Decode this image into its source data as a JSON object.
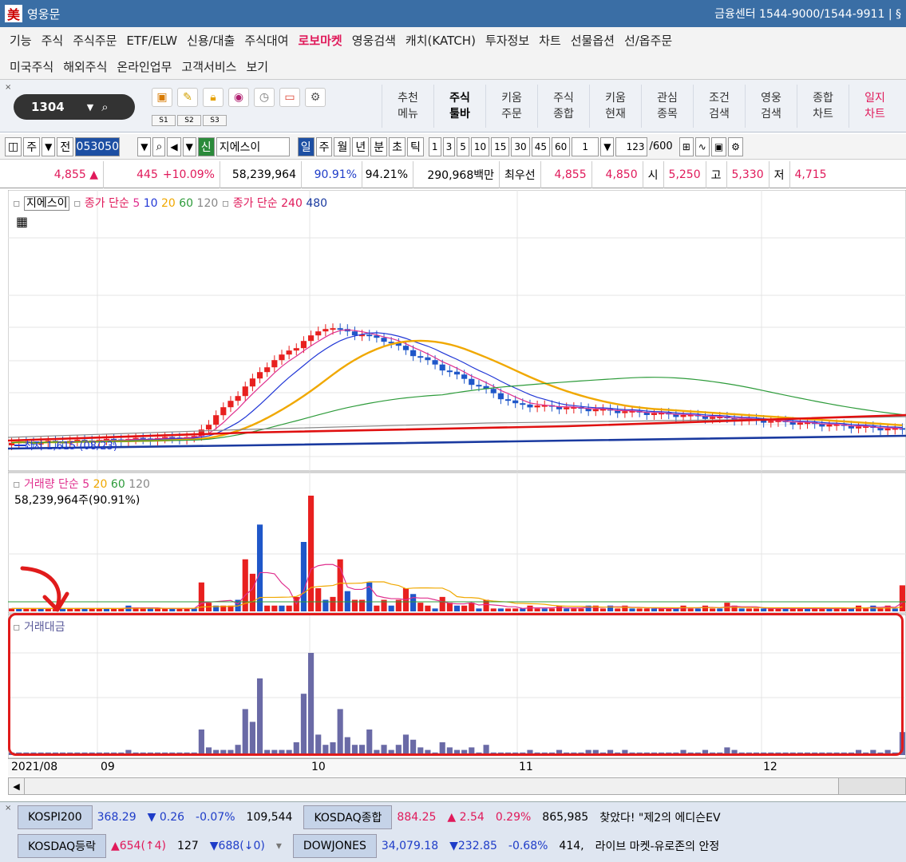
{
  "window": {
    "app_title": "영웅문",
    "logo_glyph": "美",
    "center_info": "금융센터 1544-9000/1544-9911  |  §"
  },
  "menu": {
    "row1": [
      "기능",
      "주식",
      "주식주문",
      "ETF/ELW",
      "신용/대출",
      "주식대여",
      "로보마켓",
      "영웅검색",
      "캐치(KATCH)",
      "투자정보",
      "차트",
      "선물옵션",
      "선/옵주문"
    ],
    "row1_highlight": "로보마켓",
    "row2": [
      "미국주식",
      "해외주식",
      "온라인업무",
      "고객서비스",
      "보기"
    ]
  },
  "toolbar": {
    "screen_code": "1304",
    "icons": [
      "save-icon",
      "brush-icon",
      "lock-icon",
      "camera-icon",
      "clock-icon",
      "monitor-icon",
      "gear-icon"
    ],
    "sets": [
      "S1",
      "S2",
      "S3"
    ],
    "menus": [
      {
        "l1": "추천",
        "l2": "메뉴"
      },
      {
        "l1": "주식",
        "l2": "툴바"
      },
      {
        "l1": "키움",
        "l2": "주문"
      },
      {
        "l1": "주식",
        "l2": "종합"
      },
      {
        "l1": "키움",
        "l2": "현재"
      },
      {
        "l1": "관심",
        "l2": "종목"
      },
      {
        "l1": "조건",
        "l2": "검색"
      },
      {
        "l1": "영웅",
        "l2": "검색"
      },
      {
        "l1": "종합",
        "l2": "차트"
      },
      {
        "l1": "일지",
        "l2": "차트"
      }
    ]
  },
  "controls": {
    "mode": "주",
    "scope": "전",
    "stock_code": "053050",
    "credit": "신",
    "stock_name": "지에스이",
    "periods": [
      "일",
      "주",
      "월",
      "년",
      "분",
      "초",
      "틱"
    ],
    "active_period": "일",
    "intervals": [
      "1",
      "3",
      "5",
      "10",
      "15",
      "30",
      "45",
      "60"
    ],
    "unit": "1",
    "count": "123",
    "count_total": "/600"
  },
  "quote": {
    "price": "4,855 ▲",
    "change": "445",
    "change_pct": "+10.09%",
    "volume": "58,239,964",
    "vol_ratio": "90.91%",
    "turnover": "94.21%",
    "amount": "290,968백만",
    "best_label": "최우선",
    "ask": "4,855",
    "bid": "4,850",
    "open_label": "시",
    "open": "5,250",
    "high_label": "고",
    "high": "5,330",
    "low_label": "저",
    "low": "4,715"
  },
  "price_panel": {
    "name_tag": "지에스이",
    "ma_label": "종가 단순",
    "ma_periods": [
      "5",
      "10",
      "20",
      "60",
      "120"
    ],
    "ma_label2": "종가 단순",
    "ma_periods2": [
      "240",
      "480"
    ],
    "low_marker": "최저 1,615 (08/23)"
  },
  "volume_panel": {
    "title": "거래량",
    "ma_label": "단순",
    "ma_periods": [
      "5",
      "20",
      "60",
      "120"
    ],
    "current": "58,239,964주(90.91%)"
  },
  "amount_panel": {
    "title": "거래대금"
  },
  "xaxis": [
    "2021/08",
    "09",
    "10",
    "11",
    "12"
  ],
  "colors": {
    "up": "#e8201f",
    "down": "#1f57c9",
    "amount_bar": "#6a6aa6",
    "ma5": "#e0308f",
    "ma10": "#2137d6",
    "ma20": "#f0a800",
    "ma60": "#2d9b3a",
    "ma120": "#888888",
    "ma240": "#e01010",
    "ma480": "#1a3aa0",
    "highlight": "#e01b1b"
  },
  "chart_data": {
    "type": "bar",
    "series": [
      {
        "name": "거래대금",
        "values": [
          1,
          1,
          1,
          1,
          1,
          1,
          1,
          1,
          1,
          1,
          1,
          1,
          1,
          1,
          1,
          1,
          2,
          1,
          1,
          1,
          1,
          1,
          1,
          1,
          1,
          1,
          10,
          3,
          2,
          2,
          2,
          4,
          18,
          13,
          30,
          2,
          2,
          2,
          2,
          5,
          24,
          40,
          8,
          4,
          5,
          18,
          7,
          4,
          4,
          10,
          2,
          4,
          2,
          4,
          8,
          6,
          3,
          2,
          1,
          5,
          3,
          2,
          2,
          3,
          1,
          4,
          1,
          1,
          1,
          1,
          1,
          2,
          1,
          1,
          1,
          2,
          1,
          1,
          1,
          2,
          2,
          1,
          2,
          1,
          2,
          1,
          1,
          1,
          1,
          1,
          1,
          1,
          2,
          1,
          1,
          2,
          1,
          1,
          3,
          2,
          1,
          1,
          1,
          1,
          1,
          1,
          1,
          1,
          1,
          1,
          1,
          1,
          1,
          1,
          1,
          1,
          2,
          1,
          2,
          1,
          2,
          1,
          9
        ]
      }
    ]
  },
  "ticker": {
    "row1": [
      {
        "label": "KOSPI200",
        "v1": "368.29",
        "v2": "▼ 0.26",
        "v3": "-0.07%",
        "v4": "109,544"
      },
      {
        "label": "KOSDAQ종합",
        "v1": "884.25",
        "v2": "▲ 2.54",
        "v3": "0.29%",
        "v4": "865,985"
      }
    ],
    "row1_news": "찾았다! \"제2의 에디슨EV",
    "row2": [
      {
        "label": "KOSDAQ등락",
        "v1": "▲654(↑4)",
        "v2": "127",
        "v3": "▼688(↓0)"
      },
      {
        "label": "DOWJONES",
        "v1": "34,079.18",
        "v2": "▼232.85",
        "v3": "-0.68%",
        "v4": "414,"
      }
    ],
    "row2_news": "라이브 마켓-유로존의 안정"
  }
}
